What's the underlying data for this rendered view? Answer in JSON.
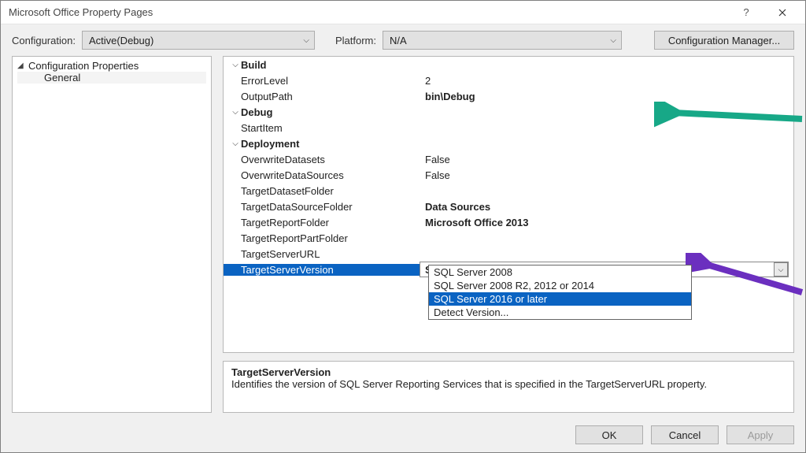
{
  "title": "Microsoft Office Property Pages",
  "toolbar": {
    "configuration_label": "Configuration:",
    "configuration_value": "Active(Debug)",
    "platform_label": "Platform:",
    "platform_value": "N/A",
    "config_manager": "Configuration Manager..."
  },
  "tree": {
    "root": "Configuration Properties",
    "child": "General"
  },
  "grid": {
    "build": {
      "cat": "Build",
      "errorlevel_k": "ErrorLevel",
      "errorlevel_v": "2",
      "outputpath_k": "OutputPath",
      "outputpath_v": "bin\\Debug"
    },
    "debug": {
      "cat": "Debug",
      "startitem_k": "StartItem",
      "startitem_v": ""
    },
    "deploy": {
      "cat": "Deployment",
      "overwrite_ds_k": "OverwriteDatasets",
      "overwrite_ds_v": "False",
      "overwrite_dsrc_k": "OverwriteDataSources",
      "overwrite_dsrc_v": "False",
      "tgt_ds_folder_k": "TargetDatasetFolder",
      "tgt_ds_folder_v": "",
      "tgt_dsrc_folder_k": "TargetDataSourceFolder",
      "tgt_dsrc_folder_v": "Data Sources",
      "tgt_report_folder_k": "TargetReportFolder",
      "tgt_report_folder_v": "Microsoft Office 2013",
      "tgt_reportpart_folder_k": "TargetReportPartFolder",
      "tgt_reportpart_folder_v": "",
      "tgt_server_url_k": "TargetServerURL",
      "tgt_server_url_v": "",
      "tgt_server_ver_k": "TargetServerVersion",
      "tgt_server_ver_v": "SQL Server 2016 or later"
    }
  },
  "dropdown": {
    "opt1": "SQL Server 2008",
    "opt2": "SQL Server 2008 R2, 2012 or 2014",
    "opt3": "SQL Server 2016 or later",
    "opt4": "Detect Version..."
  },
  "desc": {
    "header": "TargetServerVersion",
    "body": "Identifies the version of SQL Server Reporting Services that is specified in the TargetServerURL property."
  },
  "footer": {
    "ok": "OK",
    "cancel": "Cancel",
    "apply": "Apply"
  },
  "annotations": {
    "arrow_green": "#17a887",
    "arrow_purple": "#6b2fbf"
  }
}
